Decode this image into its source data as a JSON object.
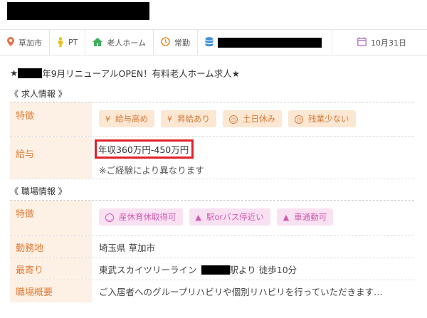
{
  "infobar": {
    "location": "草加市",
    "job_type": "PT",
    "facility": "老人ホーム",
    "employment": "常勤",
    "date": "10月31日",
    "icons": {
      "location": "map-pin-icon",
      "job_type": "person-icon",
      "facility": "house-icon",
      "employment": "clock-icon",
      "company": "database-icon",
      "date": "calendar-icon"
    }
  },
  "headline": {
    "prefix": "★",
    "text": "年9月リニューアルOPEN！有料老人ホーム求人★"
  },
  "job_section": {
    "heading": "《 求人情報 》",
    "features_label": "特徴",
    "features": [
      "給与高め",
      "昇給あり",
      "土日休み",
      "残業少ない"
    ],
    "salary_label": "給与",
    "salary_value": "年収360万円-450万円",
    "salary_note": "※ご経験により異なります"
  },
  "work_section": {
    "heading": "《 職場情報 》",
    "features_label": "特徴",
    "features": [
      "産休育休取得可",
      "駅orバス停近い",
      "車通勤可"
    ],
    "location_label": "勤務地",
    "location_value": "埼玉県 草加市",
    "station_label": "最寄り",
    "station_line": "東武スカイツリーライン",
    "station_suffix": "駅より 徒歩10分",
    "overview_label": "職場概要",
    "overview_value": "ご入居者へのグループリハビリや個別リハビリを行っていただきます…"
  },
  "colors": {
    "label_bg": "#fdf0e4",
    "label_text": "#e07d3a",
    "tag_orange_bg": "#fbe7d2",
    "tag_pink_bg": "#f9e1f2",
    "highlight": "#e0202a"
  }
}
